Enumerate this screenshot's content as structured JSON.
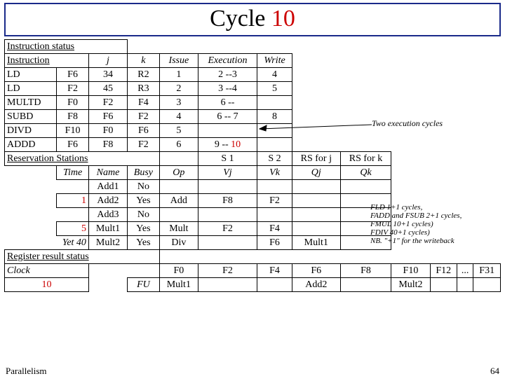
{
  "title": {
    "main": "Cycle ",
    "num": "10"
  },
  "headers": {
    "instr_status": "Instruction status",
    "instruction": "Instruction",
    "j": "j",
    "k": "k",
    "issue": "Issue",
    "execution": "Execution",
    "write": "Write",
    "reservation": "Reservation Stations",
    "s1": "S 1",
    "s2": "S 2",
    "rsj": "RS for j",
    "rsk": "RS for k",
    "time": "Time",
    "name": "Name",
    "busy": "Busy",
    "op": "Op",
    "vj": "Vj",
    "vk": "Vk",
    "qj": "Qj",
    "qk": "Qk",
    "reg_status": "Register result status",
    "clock": "Clock",
    "fu": "FU"
  },
  "instr": [
    {
      "op": "LD",
      "d": "F6",
      "j": "34",
      "k": "R2",
      "issue": "1",
      "exec": "2 --3",
      "write": "4"
    },
    {
      "op": "LD",
      "d": "F2",
      "j": "45",
      "k": "R3",
      "issue": "2",
      "exec": "3 --4",
      "write": "5"
    },
    {
      "op": "MULTD",
      "d": "F0",
      "j": "F2",
      "k": "F4",
      "issue": "3",
      "exec": "6 --",
      "write": ""
    },
    {
      "op": "SUBD",
      "d": "F8",
      "j": "F6",
      "k": "F2",
      "issue": "4",
      "exec": "6 -- 7",
      "write": "8"
    },
    {
      "op": "DIVD",
      "d": "F10",
      "j": "F0",
      "k": "F6",
      "issue": "5",
      "exec": "",
      "write": ""
    },
    {
      "op": "ADDD",
      "d": "F6",
      "j": "F8",
      "k": "F2",
      "issue": "6",
      "exec_pre": "9 -- ",
      "exec_red": "10",
      "write": ""
    }
  ],
  "rs": [
    {
      "time_red": "",
      "name": "Add1",
      "busy": "No",
      "op": "",
      "vj": "",
      "vk": "",
      "qj": "",
      "qk": ""
    },
    {
      "time_red": "1",
      "name": "Add2",
      "busy": "Yes",
      "op": "Add",
      "vj": "F8",
      "vk": "F2",
      "qj": "",
      "qk": ""
    },
    {
      "time_red": "",
      "name": "Add3",
      "busy": "No",
      "op": "",
      "vj": "",
      "vk": "",
      "qj": "",
      "qk": ""
    },
    {
      "time_red": "5",
      "name": "Mult1",
      "busy": "Yes",
      "op": "Mult",
      "vj": "F2",
      "vk": "F4",
      "qj": "",
      "qk": ""
    },
    {
      "time_pre": "Yet 40",
      "name": "Mult2",
      "busy": "Yes",
      "op": "Div",
      "vj": "",
      "vk": "F6",
      "qj": "Mult1",
      "qk": ""
    }
  ],
  "clock_val": "10",
  "reg": {
    "labels": [
      "F0",
      "F2",
      "F4",
      "F6",
      "F8",
      "F10",
      "F12",
      "...",
      "F31"
    ],
    "fu": [
      "Mult1",
      "",
      "",
      "Add2",
      "",
      "Mult2",
      "",
      "",
      ""
    ]
  },
  "annot": {
    "two_exec": "Two execution cycles",
    "lat1": "FLD 1+1 cycles,",
    "lat2": "FADD and FSUB 2+1 cycles,",
    "lat3": "FMUL 10+1 cycles)",
    "lat4": "FDIV 40+1 cycles)",
    "lat5": "NB. \"+1\" for the writeback"
  },
  "footer": {
    "left": "Parallelism",
    "right": "64"
  }
}
